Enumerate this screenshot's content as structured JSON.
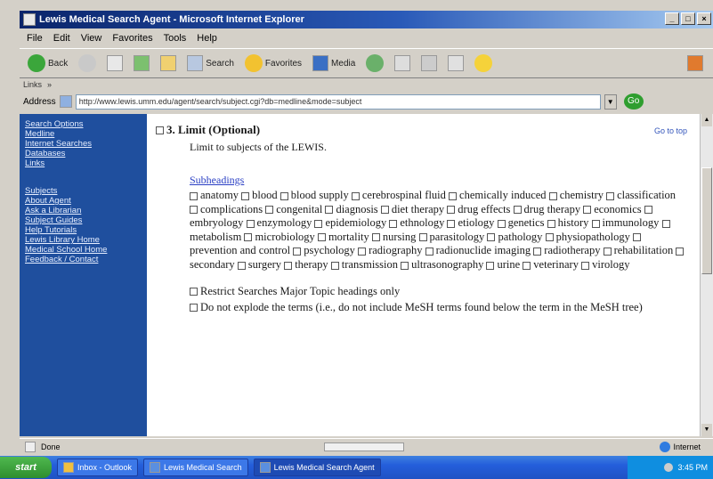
{
  "window": {
    "title": "Lewis Medical Search Agent - Microsoft Internet Explorer",
    "controls": [
      "_",
      "□",
      "×"
    ]
  },
  "menu": [
    "File",
    "Edit",
    "View",
    "Favorites",
    "Tools",
    "Help"
  ],
  "toolbar": {
    "back": "Back",
    "search": "Search",
    "favorites": "Favorites",
    "media": "Media"
  },
  "links_label": "Links",
  "address": {
    "label": "Address",
    "value": "http://www.lewis.umm.edu/agent/search/subject.cgi?db=medline&mode=subject",
    "go": "Go"
  },
  "sidebar": {
    "group1": [
      "Search Options",
      "Medline",
      "Internet Searches",
      "Databases",
      "Links"
    ],
    "group2": [
      "Subjects",
      "About Agent",
      "Ask a Librarian",
      "Subject Guides",
      "Help Tutorials",
      "Lewis Library Home",
      "Medical School Home",
      "Feedback / Contact"
    ]
  },
  "content": {
    "heading": "3. Limit (Optional)",
    "subheading": "Limit to subjects of the LEWIS.",
    "top_link": "Go to top",
    "subjects_title": "Subheadings",
    "subjects": [
      "anatomy",
      "blood",
      "blood supply",
      "cerebrospinal fluid",
      "chemically induced",
      "chemistry",
      "classification",
      "complications",
      "congenital",
      "diagnosis",
      "diet therapy",
      "drug effects",
      "drug therapy",
      "economics",
      "embryology",
      "enzymology",
      "epidemiology",
      "ethnology",
      "etiology",
      "genetics",
      "history",
      "immunology",
      "metabolism",
      "microbiology",
      "mortality",
      "nursing",
      "parasitology",
      "pathology",
      "physiopathology",
      "prevention and control",
      "psychology",
      "radiography",
      "radionuclide imaging",
      "radiotherapy",
      "rehabilitation",
      "secondary",
      "surgery",
      "therapy",
      "transmission",
      "ultrasonography",
      "urine",
      "veterinary",
      "virology"
    ],
    "note1": "Restrict Searches Major Topic headings only",
    "note2": "Do not explode the terms (i.e., do not include MeSH terms found below the term in the MeSH tree)"
  },
  "status": {
    "text": "Done",
    "progress": 0,
    "zone": "Internet"
  },
  "taskbar": {
    "start": "start",
    "tasks": [
      "Inbox - Outlook",
      "Lewis Medical Search",
      "Lewis Medical Search Agent"
    ],
    "clock": "3:45 PM"
  }
}
